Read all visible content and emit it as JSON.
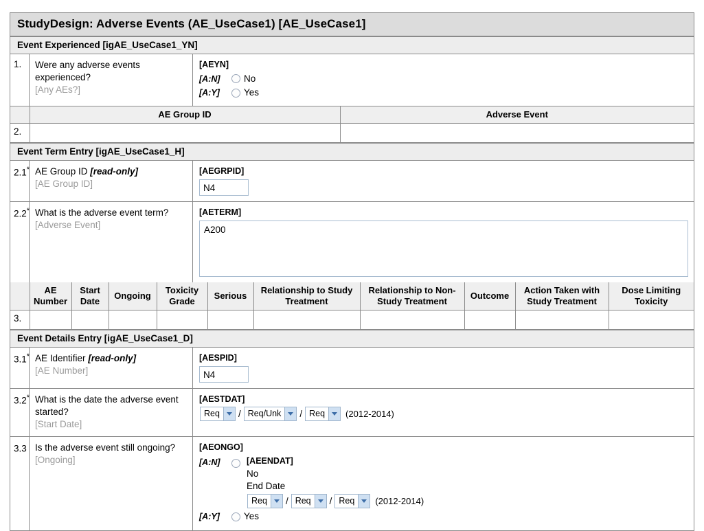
{
  "form": {
    "title": "StudyDesign: Adverse Events (AE_UseCase1) [AE_UseCase1]",
    "sections": {
      "yn": "Event Experienced [igAE_UseCase1_YN]",
      "term": "Event Term Entry [igAE_UseCase1_H]",
      "details": "Event Details Entry [igAE_UseCase1_D]"
    }
  },
  "q1": {
    "num": "1.",
    "text": "Were any adverse events experienced?",
    "alias": "[Any AEs?]",
    "varname": "[AEYN]",
    "options": [
      {
        "code": "[A:N]",
        "label": "No"
      },
      {
        "code": "[A:Y]",
        "label": "Yes"
      }
    ]
  },
  "grid_h": {
    "rownum": "2.",
    "columns": [
      "AE Group ID",
      "Adverse Event"
    ],
    "rows": [
      [
        "",
        ""
      ]
    ]
  },
  "q21": {
    "num": "2.1",
    "star": "*",
    "text": "AE Group ID",
    "readonly": "[read-only]",
    "alias": "[AE Group ID]",
    "varname": "[AEGRPID]",
    "value": "N4"
  },
  "q22": {
    "num": "2.2",
    "star": "*",
    "text": "What is the adverse event term?",
    "alias": "[Adverse Event]",
    "varname": "[AETERM]",
    "value": "A200"
  },
  "grid_d": {
    "rownum": "3.",
    "columns": [
      "AE Number",
      "Start Date",
      "Ongoing",
      "Toxicity Grade",
      "Serious",
      "Relationship to Study Treatment",
      "Relationship to Non-Study Treatment",
      "Outcome",
      "Action Taken with Study Treatment",
      "Dose Limiting Toxicity"
    ],
    "rows": [
      [
        "",
        "",
        "",
        "",
        "",
        "",
        "",
        "",
        "",
        ""
      ]
    ]
  },
  "q31": {
    "num": "3.1",
    "star": "*",
    "text": "AE Identifier",
    "readonly": "[read-only]",
    "alias": "[AE Number]",
    "varname": "[AESPID]",
    "value": "N4"
  },
  "q32": {
    "num": "3.2",
    "star": "*",
    "text": "What is the date the adverse event started?",
    "alias": "[Start Date]",
    "varname": "[AESTDAT]",
    "selects": [
      "Req",
      "Req/Unk",
      "Req"
    ],
    "year_range": "(2012-2014)",
    "sep": "/"
  },
  "q33": {
    "num": "3.3",
    "star": "",
    "text": "Is the adverse event still ongoing?",
    "alias": "[Ongoing]",
    "varname": "[AEONGO]",
    "no_code": "[A:N]",
    "no_label": "No",
    "end_varname": "[AEENDAT]",
    "end_label": "End Date",
    "end_selects": [
      "Req",
      "Req",
      "Req"
    ],
    "end_year_range": "(2012-2014)",
    "sep": "/",
    "yes_code": "[A:Y]",
    "yes_label": "Yes"
  }
}
